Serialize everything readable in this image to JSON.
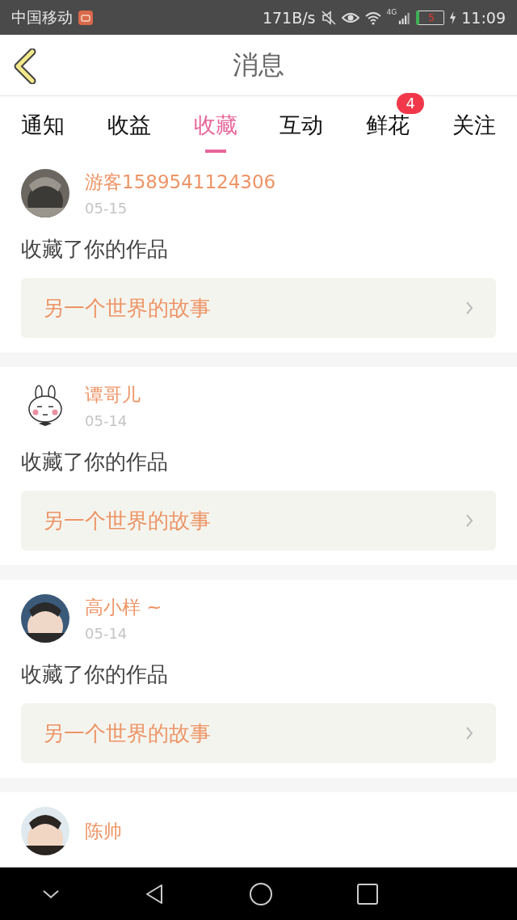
{
  "status_bar": {
    "carrier": "中国移动",
    "speed": "171B/s",
    "network": "4G",
    "battery": "5",
    "time": "11:09"
  },
  "header": {
    "title": "消息"
  },
  "tabs": [
    {
      "label": "通知",
      "selected": false
    },
    {
      "label": "收益",
      "selected": false
    },
    {
      "label": "收藏",
      "selected": true
    },
    {
      "label": "互动",
      "selected": false
    },
    {
      "label": "鲜花",
      "selected": false,
      "badge": "4"
    },
    {
      "label": "关注",
      "selected": false
    }
  ],
  "messages": [
    {
      "kind": "picture",
      "name": "游客1589541124306",
      "date": "05-15",
      "text": "收藏了你的作品",
      "work": "另一个世界的故事"
    },
    {
      "kind": "cartoon",
      "name": "谭哥儿",
      "date": "05-14",
      "text": "收藏了你的作品",
      "work": "另一个世界的故事"
    },
    {
      "kind": "picture",
      "name": "高小样 ~",
      "date": "05-14",
      "text": "收藏了你的作品",
      "work": "另一个世界的故事"
    },
    {
      "kind": "picture",
      "name": "陈帅"
    }
  ]
}
